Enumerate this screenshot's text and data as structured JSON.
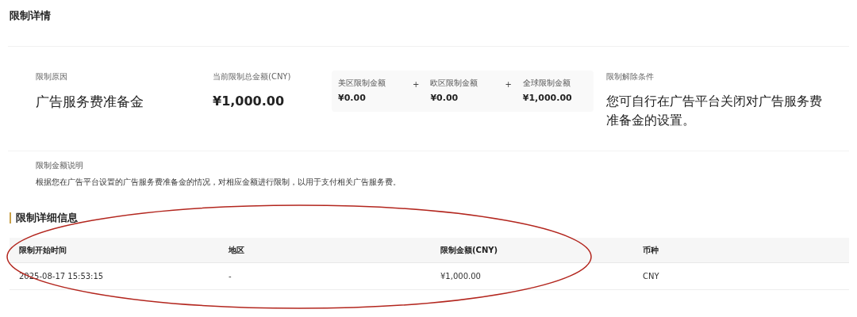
{
  "page_title": "限制详情",
  "summary": {
    "reason_label": "限制原因",
    "reason": "广告服务费准备金",
    "total_label": "当前限制总金额(CNY)",
    "total": "¥1,000.00",
    "regions": [
      {
        "label": "美区限制金额",
        "amount": "¥0.00"
      },
      {
        "label": "欧区限制金额",
        "amount": "¥0.00"
      },
      {
        "label": "全球限制金额",
        "amount": "¥1,000.00"
      }
    ],
    "region_separator": "+",
    "release_label": "限制解除条件",
    "release": "您可自行在广告平台关闭对广告服务费准备金的设置。"
  },
  "explanation": {
    "label": "限制金额说明",
    "text": "根据您在广告平台设置的广告服务费准备金的情况，对相应金额进行限制，以用于支付相关广告服务费。"
  },
  "details": {
    "title": "限制详细信息",
    "columns": [
      "限制开始时间",
      "地区",
      "限制金额(CNY)",
      "币种"
    ],
    "rows": [
      [
        "2025-08-17 15:53:15",
        "-",
        "¥1,000.00",
        "CNY"
      ]
    ]
  }
}
